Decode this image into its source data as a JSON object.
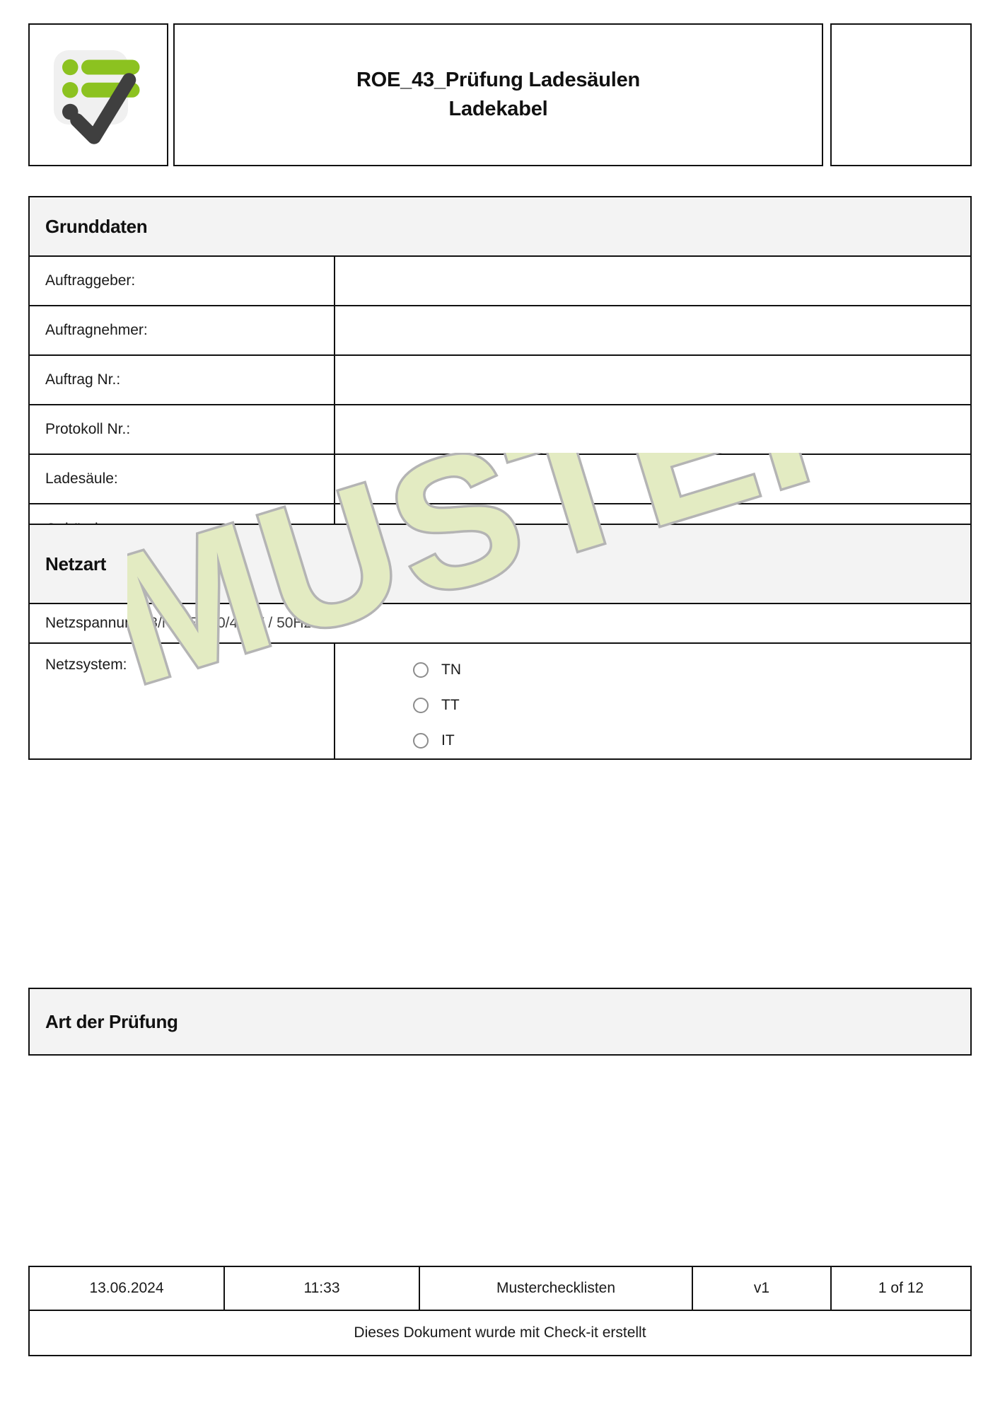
{
  "header": {
    "logo_icon": "checklist-check-logo",
    "title": "ROE_43_Prüfung Ladesäulen\nLadekabel",
    "title_line1": "ROE_43_Prüfung Ladesäulen",
    "title_line2": "Ladekabel",
    "right_box_text": ""
  },
  "watermark": {
    "text": "MUSTER",
    "fill_color": "#e0e8bd",
    "stroke_color": "#b0b0b0"
  },
  "sections": {
    "grunddaten": {
      "heading": "Grunddaten",
      "rows": [
        {
          "label": "Auftraggeber:",
          "value": ""
        },
        {
          "label": "Auftragnehmer:",
          "value": ""
        },
        {
          "label": "Auftrag Nr.:",
          "value": ""
        },
        {
          "label": "Protokoll Nr.:",
          "value": ""
        },
        {
          "label": "Ladesäule:",
          "value": ""
        },
        {
          "label": "Gebäude:",
          "value": ""
        }
      ]
    },
    "netzart": {
      "heading": "Netzart",
      "netzspannung_label": "Netzspannung:",
      "netzspannung_value": "3/N/PE  230/400V / 50Hz",
      "netzsystem_label": "Netzsystem:",
      "netzsystem_options": [
        {
          "label": "TN",
          "selected": false
        },
        {
          "label": "TT",
          "selected": false
        },
        {
          "label": "IT",
          "selected": false
        }
      ]
    },
    "art_der_pruefung": {
      "heading": "Art der Prüfung"
    }
  },
  "footer": {
    "date": "13.06.2024",
    "time": "11:33",
    "document": "Musterchecklisten",
    "version": "v1",
    "page": "1 of 12",
    "note": "Dieses Dokument wurde mit Check-it erstellt"
  }
}
